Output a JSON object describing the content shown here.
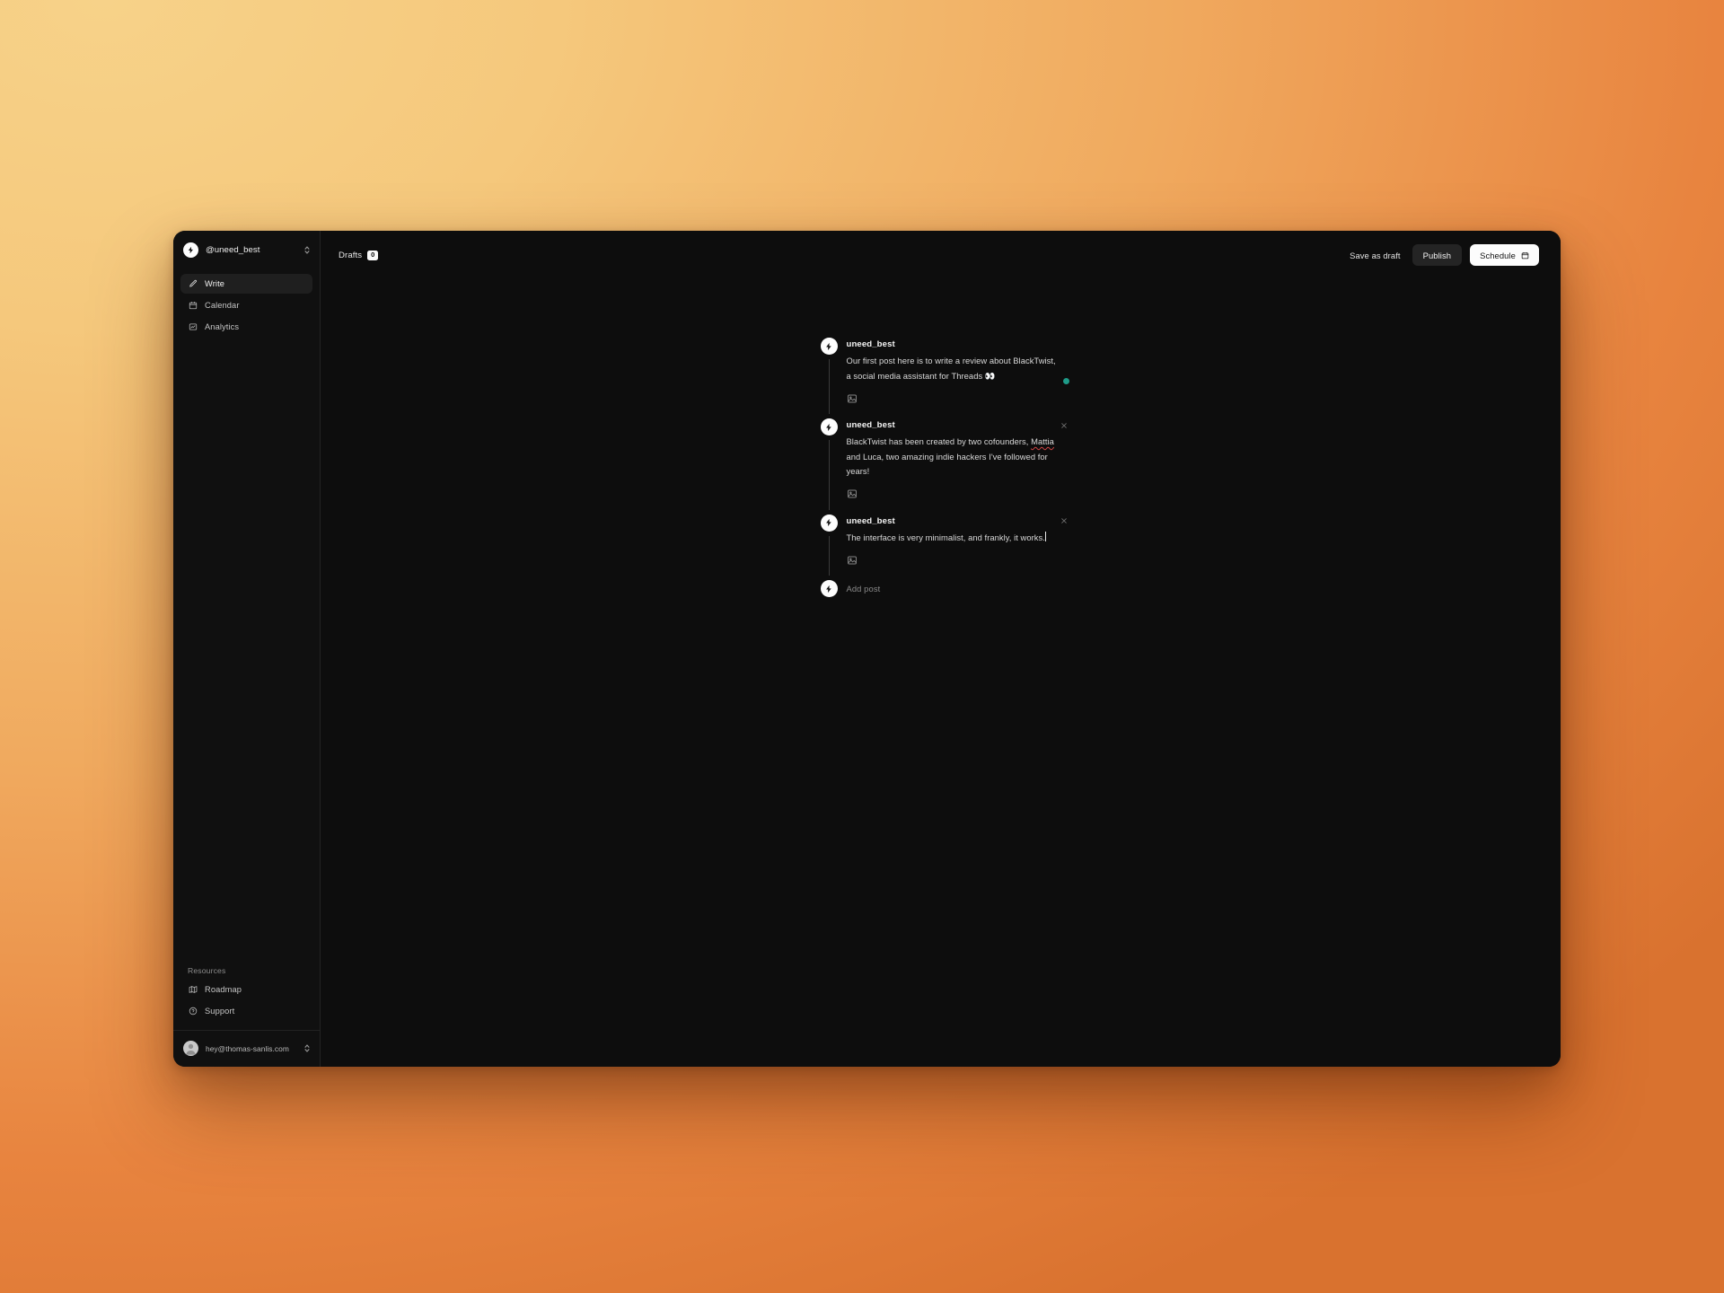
{
  "theme": {
    "window_bg": "#0d0d0d",
    "sidebar_bg": "#101010",
    "accent_teal": "#1e9b88",
    "badge_bg": "#fafafa",
    "bg_gradient_start": "#f7d289",
    "bg_gradient_end": "#d9722f"
  },
  "sidebar": {
    "account": {
      "handle": "@uneed_best",
      "avatar_icon": "bolt-icon",
      "switcher_icon": "chevron-up-down-icon"
    },
    "nav_items": [
      {
        "label": "Write",
        "icon": "pencil-icon",
        "active": true
      },
      {
        "label": "Calendar",
        "icon": "calendar-icon",
        "active": false
      },
      {
        "label": "Analytics",
        "icon": "chart-icon",
        "active": false
      }
    ],
    "resources": {
      "heading": "Resources",
      "items": [
        {
          "label": "Roadmap",
          "icon": "map-icon"
        },
        {
          "label": "Support",
          "icon": "question-circle-icon"
        }
      ]
    },
    "footer": {
      "email": "hey@thomas-sanlis.com",
      "avatar_icon": "person-icon",
      "switcher_icon": "chevron-up-down-icon"
    }
  },
  "topbar": {
    "drafts_label": "Drafts",
    "drafts_count": "0",
    "save_draft_label": "Save as draft",
    "publish_label": "Publish",
    "schedule_label": "Schedule",
    "schedule_icon": "calendar-icon"
  },
  "composer": {
    "posts": [
      {
        "author": "uneed_best",
        "text_before": "Our first post here is to write a review about BlackTwist, a social media assistant for Threads ",
        "emoji": "👀",
        "misspelled": "",
        "text_after": "",
        "attach_icon": "image-icon",
        "has_status_dot": true,
        "has_remove": false,
        "has_caret": false
      },
      {
        "author": "uneed_best",
        "text_before": "BlackTwist has been created by two cofounders, ",
        "emoji": "",
        "misspelled": "Mattia",
        "text_after": " and Luca, two amazing indie hackers I've followed for years!",
        "attach_icon": "image-icon",
        "has_status_dot": false,
        "has_remove": true,
        "has_caret": false
      },
      {
        "author": "uneed_best",
        "text_before": "The interface is very minimalist, and frankly, it works.",
        "emoji": "",
        "misspelled": "",
        "text_after": "",
        "attach_icon": "image-icon",
        "has_status_dot": false,
        "has_remove": true,
        "has_caret": true
      }
    ],
    "add_post_label": "Add post",
    "add_post_icon": "bolt-icon",
    "remove_icon": "close-icon"
  }
}
